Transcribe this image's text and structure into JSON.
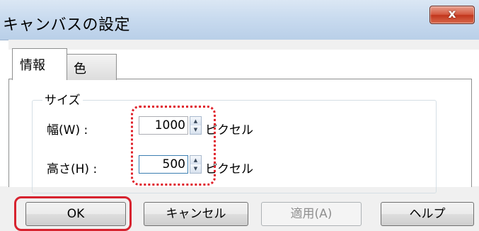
{
  "window": {
    "title": "キャンバスの設定",
    "close_label": "x"
  },
  "tabs": [
    {
      "label": "情報",
      "selected": true
    },
    {
      "label": "色",
      "selected": false
    }
  ],
  "size_group": {
    "label": "サイズ",
    "width": {
      "label": "幅(W) :",
      "value": "1000",
      "unit": "ピクセル"
    },
    "height": {
      "label": "高さ(H) :",
      "value": "500",
      "unit": "ピクセル"
    }
  },
  "buttons": {
    "ok": "OK",
    "cancel": "キャンセル",
    "apply": "適用(A)",
    "help": "ヘルプ"
  },
  "colors": {
    "highlight": "#e0202a",
    "titlebar": "#c9dbef",
    "close_button": "#c2351c"
  }
}
